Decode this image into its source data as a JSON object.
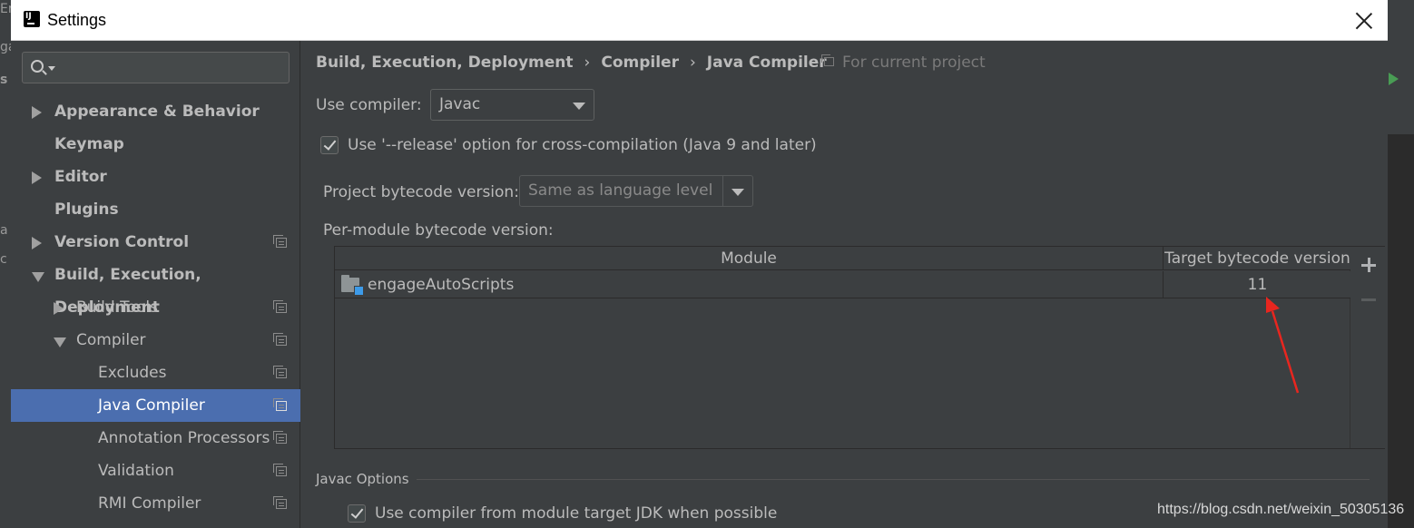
{
  "window": {
    "title": "Settings"
  },
  "background_fragments": [
    "Er",
    "ga",
    "s",
    "a",
    "c"
  ],
  "search": {
    "placeholder": ""
  },
  "sidebar": {
    "items": [
      {
        "label": "Appearance & Behavior",
        "expander": "collapsed",
        "level": 0,
        "bold": true,
        "project_icon": false,
        "selected": false
      },
      {
        "label": "Keymap",
        "expander": "none",
        "level": 0,
        "bold": true,
        "project_icon": false,
        "selected": false
      },
      {
        "label": "Editor",
        "expander": "collapsed",
        "level": 0,
        "bold": true,
        "project_icon": false,
        "selected": false
      },
      {
        "label": "Plugins",
        "expander": "none",
        "level": 0,
        "bold": true,
        "project_icon": false,
        "selected": false
      },
      {
        "label": "Version Control",
        "expander": "collapsed",
        "level": 0,
        "bold": true,
        "project_icon": true,
        "selected": false
      },
      {
        "label": "Build, Execution, Deployment",
        "expander": "expanded",
        "level": 0,
        "bold": true,
        "project_icon": false,
        "selected": false
      },
      {
        "label": "Build Tools",
        "expander": "collapsed",
        "level": 1,
        "bold": false,
        "project_icon": true,
        "selected": false
      },
      {
        "label": "Compiler",
        "expander": "expanded",
        "level": 1,
        "bold": false,
        "project_icon": true,
        "selected": false
      },
      {
        "label": "Excludes",
        "expander": "none",
        "level": 2,
        "bold": false,
        "project_icon": true,
        "selected": false
      },
      {
        "label": "Java Compiler",
        "expander": "none",
        "level": 2,
        "bold": false,
        "project_icon": true,
        "selected": true
      },
      {
        "label": "Annotation Processors",
        "expander": "none",
        "level": 2,
        "bold": false,
        "project_icon": true,
        "selected": false
      },
      {
        "label": "Validation",
        "expander": "none",
        "level": 2,
        "bold": false,
        "project_icon": true,
        "selected": false
      },
      {
        "label": "RMI Compiler",
        "expander": "none",
        "level": 2,
        "bold": false,
        "project_icon": true,
        "selected": false
      }
    ]
  },
  "breadcrumb": {
    "items": [
      "Build, Execution, Deployment",
      "Compiler",
      "Java Compiler"
    ],
    "separator": "›",
    "scope_note": "For current project"
  },
  "compiler": {
    "use_compiler_label": "Use compiler:",
    "use_compiler_value": "Javac",
    "release_option_label": "Use '--release' option for cross-compilation (Java 9 and later)",
    "release_option_checked": true,
    "project_bytecode_label": "Project bytecode version:",
    "project_bytecode_value": "Same as language level",
    "per_module_label": "Per-module bytecode version:"
  },
  "module_table": {
    "columns": [
      "Module",
      "Target bytecode version"
    ],
    "rows": [
      {
        "module": "engageAutoScripts",
        "target": "11"
      }
    ]
  },
  "javac_options": {
    "section_title": "Javac Options",
    "use_module_jdk_label": "Use compiler from module target JDK when possible",
    "use_module_jdk_checked": true
  },
  "watermark": "https://blog.csdn.net/weixin_50305136",
  "colors": {
    "dialog_bg": "#3c3f41",
    "selection": "#4b6eaf",
    "annotation_arrow": "#e8261f",
    "module_badge": "#3d9be9"
  }
}
